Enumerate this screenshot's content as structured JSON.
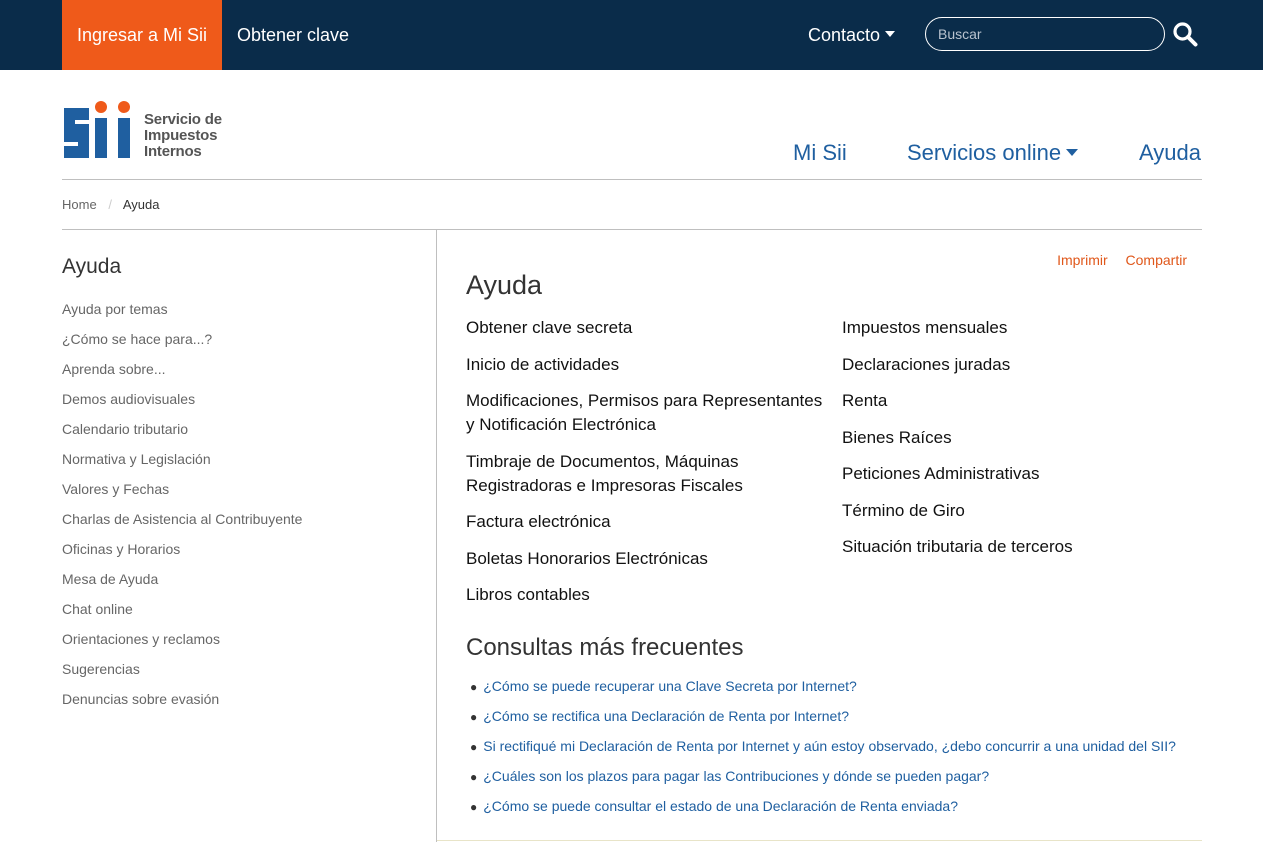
{
  "topbar": {
    "login_label": "Ingresar a Mi Sii",
    "clave_label": "Obtener clave",
    "contacto_label": "Contacto",
    "search_placeholder": "Buscar"
  },
  "header": {
    "logo_text_line1": "Servicio de",
    "logo_text_line2": "Impuestos",
    "logo_text_line3": "Internos",
    "nav": {
      "misii": "Mi Sii",
      "servicios": "Servicios online",
      "ayuda": "Ayuda"
    }
  },
  "breadcrumb": {
    "home": "Home",
    "separator": "/",
    "current": "Ayuda"
  },
  "sidebar": {
    "title": "Ayuda",
    "items": [
      "Ayuda por temas",
      "¿Cómo se hace para...?",
      "Aprenda sobre...",
      "Demos audiovisuales",
      "Calendario tributario",
      "Normativa y Legislación",
      "Valores y Fechas",
      "Charlas de Asistencia al Contribuyente",
      "Oficinas y Horarios",
      "Mesa de Ayuda",
      "Chat online",
      "Orientaciones y reclamos",
      "Sugerencias",
      "Denuncias sobre evasión"
    ]
  },
  "main": {
    "imprimir": "Imprimir",
    "compartir": "Compartir",
    "title": "Ayuda",
    "left_links": [
      "Obtener clave secreta",
      "Inicio de actividades",
      "Modificaciones, Permisos para Representantes y Notificación Electrónica",
      "Timbraje de Documentos, Máquinas Registradoras e Impresoras Fiscales",
      "Factura electrónica",
      "Boletas Honorarios Electrónicas",
      "Libros contables"
    ],
    "right_links": [
      "Impuestos mensuales",
      "Declaraciones juradas",
      "Renta",
      "Bienes Raíces",
      "Peticiones Administrativas",
      "Término de Giro",
      "Situación tributaria de terceros"
    ],
    "faq_title": "Consultas más frecuentes",
    "faq": [
      "¿Cómo se puede recuperar una Clave Secreta por Internet?",
      "¿Cómo se rectifica una Declaración de Renta por Internet?",
      "Si rectifiqué mi Declaración de Renta por Internet y aún estoy observado, ¿debo concurrir a una unidad del SII?",
      "¿Cuáles son los plazos para pagar las Contribuciones y dónde se pueden pagar?",
      "¿Cómo se puede consultar el estado de una Declaración de Renta enviada?"
    ]
  },
  "colors": {
    "topbar_bg": "#0a2c4a",
    "accent_orange": "#ef5a1a",
    "link_blue": "#1f5fa0",
    "logo_blue": "#1f5fa0"
  }
}
